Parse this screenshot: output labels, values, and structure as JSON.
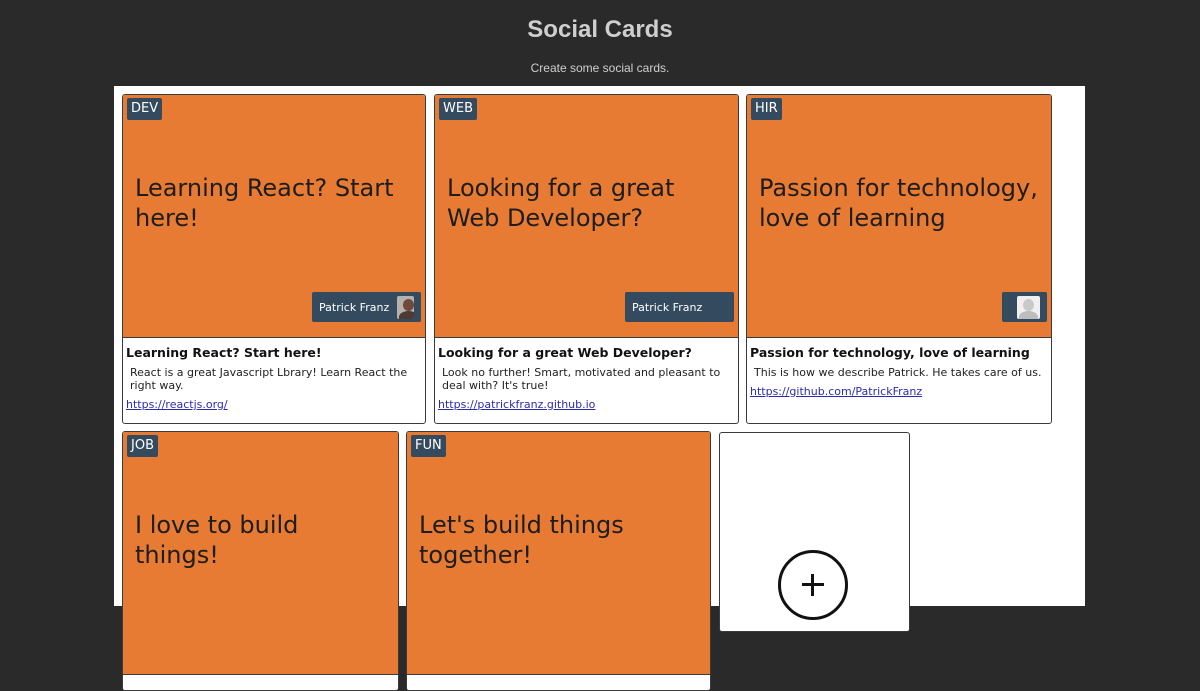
{
  "header": {
    "title": "Social Cards",
    "subtitle": "Create some social cards."
  },
  "cards": [
    {
      "tag": "DEV",
      "hero_title": "Learning React? Start here!",
      "author": "Patrick Franz",
      "avatar": "photo-avatar",
      "body_title": "Learning React? Start here!",
      "body_text": "React is a great Javascript Lbrary! Learn React the right way.",
      "link": "https://reactjs.org/"
    },
    {
      "tag": "WEB",
      "hero_title": "Looking for a great Web Developer?",
      "author": "Patrick Franz",
      "avatar": "none",
      "body_title": "Looking for a great Web Developer?",
      "body_text": "Look no further! Smart, motivated and pleasant to deal with? It's true!",
      "link": "https://patrickfranz.github.io"
    },
    {
      "tag": "HIR",
      "hero_title": "Passion for technology, love of learning",
      "author": "",
      "avatar": "placeholder-avatar",
      "body_title": "Passion for technology, love of learning",
      "body_text": "This is how we describe Patrick. He takes care of us.",
      "link": "https://github.com/PatrickFranz"
    },
    {
      "tag": "JOB",
      "hero_title": "I love to build things!"
    },
    {
      "tag": "FUN",
      "hero_title": "Let's build things together!"
    }
  ],
  "add_card": {
    "icon": "plus-circle-icon"
  },
  "colors": {
    "background": "#2a2a2a",
    "card_hero": "#e77b33",
    "tag_bg": "#344a5e",
    "link": "#2b2bb0"
  }
}
